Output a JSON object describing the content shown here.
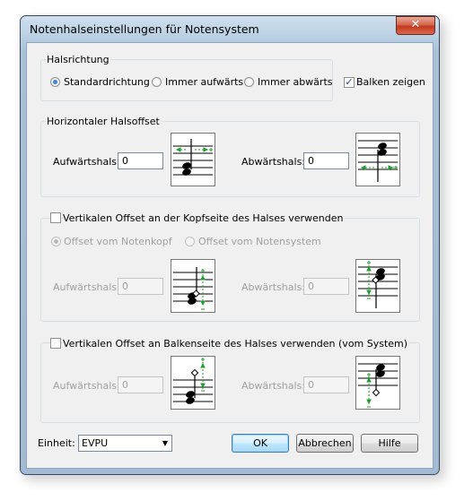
{
  "window": {
    "title": "Notenhalseinstellungen für Notensystem",
    "close_label": "✕"
  },
  "halsrichtung": {
    "title": "Halsrichtung",
    "options": [
      "Standardrichtung",
      "Immer aufwärts",
      "Immer abwärts"
    ],
    "selected": "Standardrichtung",
    "balken_label": "Balken zeigen",
    "balken_checked": true
  },
  "horizontal": {
    "title": "Horizontaler Halsoffset",
    "up_label": "Aufwärtshals:",
    "up_value": "0",
    "down_label": "Abwärtshals:",
    "down_value": "0"
  },
  "vertical_head": {
    "title": "Vertikalen Offset an der Kopfseite des Halses verwenden",
    "checked": false,
    "options": [
      "Offset vom Notenkopf",
      "Offset vom Notensystem"
    ],
    "selected": "Offset vom Notenkopf",
    "up_label": "Aufwärtshals:",
    "up_value": "0",
    "down_label": "Abwärtshals:",
    "down_value": "0"
  },
  "vertical_beam": {
    "title": "Vertikalen Offset an Balkenseite des Halses verwenden (vom System)",
    "checked": false,
    "up_label": "Aufwärtshals:",
    "up_value": "0",
    "down_label": "Abwärtshals:",
    "down_value": "0"
  },
  "footer": {
    "einheit_label": "Einheit:",
    "einheit_value": "EVPU",
    "ok": "OK",
    "cancel": "Abbrechen",
    "help": "Hilfe"
  },
  "colors": {
    "accent_green": "#1e9e2e",
    "title_bar": "#b9cfe2",
    "close_red": "#c3391f"
  }
}
